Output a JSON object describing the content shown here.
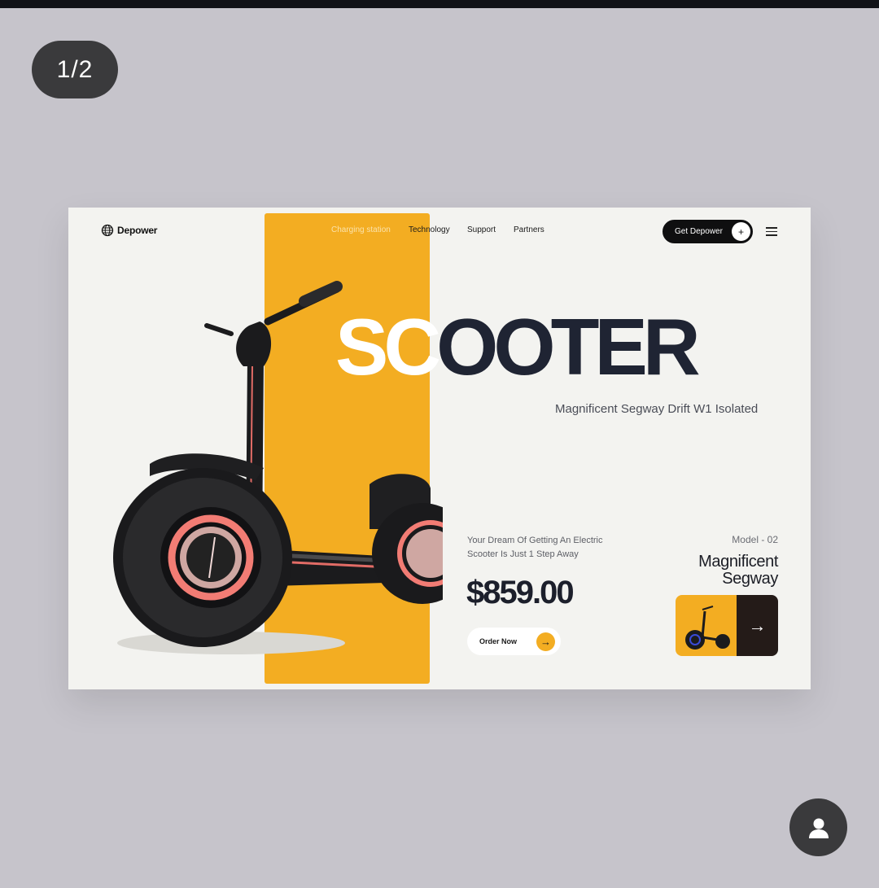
{
  "viewer": {
    "counter": "1/2"
  },
  "site": {
    "brand": "Depower",
    "nav": [
      "Charging station",
      "Technology",
      "Support",
      "Partners"
    ],
    "cta_label": "Get Depower",
    "cta_icon": "+"
  },
  "hero": {
    "headline_light": "SC",
    "headline_dark": "OOTER",
    "subtitle": "Magnificent Segway Drift W1 Isolated",
    "tagline_line1": "Your Dream Of Getting An Electric",
    "tagline_line2": "Scooter Is Just 1 Step Away",
    "price": "$859.00",
    "order_label": "Order Now"
  },
  "model": {
    "label": "Model - 02",
    "name_line1": "Magnificent",
    "name_line2": "Segway"
  },
  "colors": {
    "accent_yellow": "#f3ad22",
    "dark_text": "#1f2433",
    "card_bg": "#f3f3f0",
    "viewer_bg": "#c6c4cb"
  },
  "icons": {
    "brand": "globe-icon",
    "menu": "hamburger-menu-icon",
    "order": "arrow-right-icon",
    "thumb": "arrow-right-icon",
    "account": "person-icon"
  }
}
